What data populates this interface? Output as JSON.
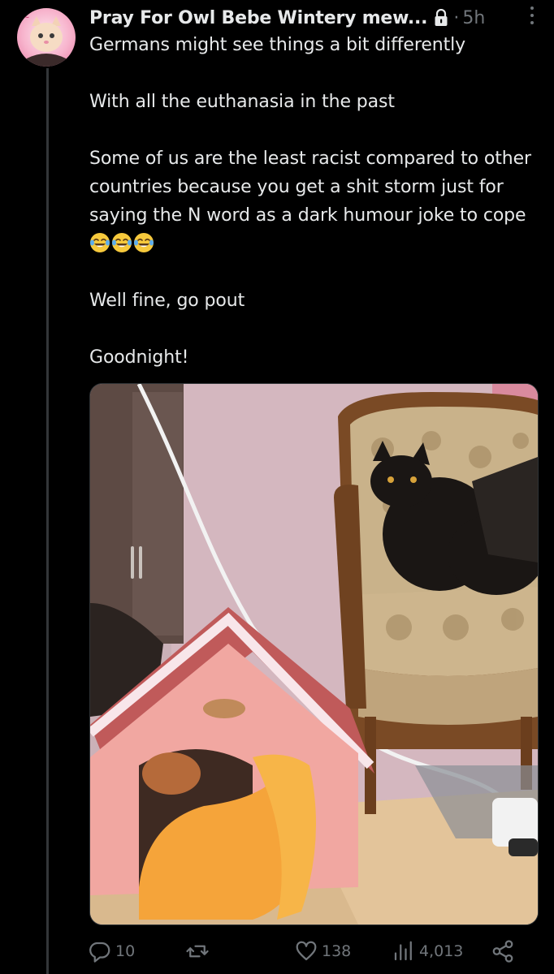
{
  "tweet": {
    "display_name": "Pray For Owl Bebe Wintery mew...",
    "separator": "·",
    "time": "5h",
    "paragraphs": [
      "Germans might see things a bit differently",
      "With all the euthanasia in the past",
      "Some of us are the least racist compared to other countries because you get a shit storm just for saying the N word as a dark humour joke to cope",
      "Well fine, go pout",
      "Goodnight!"
    ],
    "emoji_count": 3,
    "media_description_icon": "photo"
  },
  "actions": {
    "replies": "10",
    "reposts": "",
    "likes": "138",
    "views": "4,013"
  },
  "colors": {
    "background": "#000000",
    "text": "#e7e9ea",
    "muted": "#71767b",
    "thread_line": "#333639"
  },
  "icons": {
    "lock": "lock-icon",
    "more": "more-icon",
    "reply": "reply-icon",
    "repost": "repost-icon",
    "like": "heart-icon",
    "views": "views-icon",
    "share": "share-icon"
  }
}
